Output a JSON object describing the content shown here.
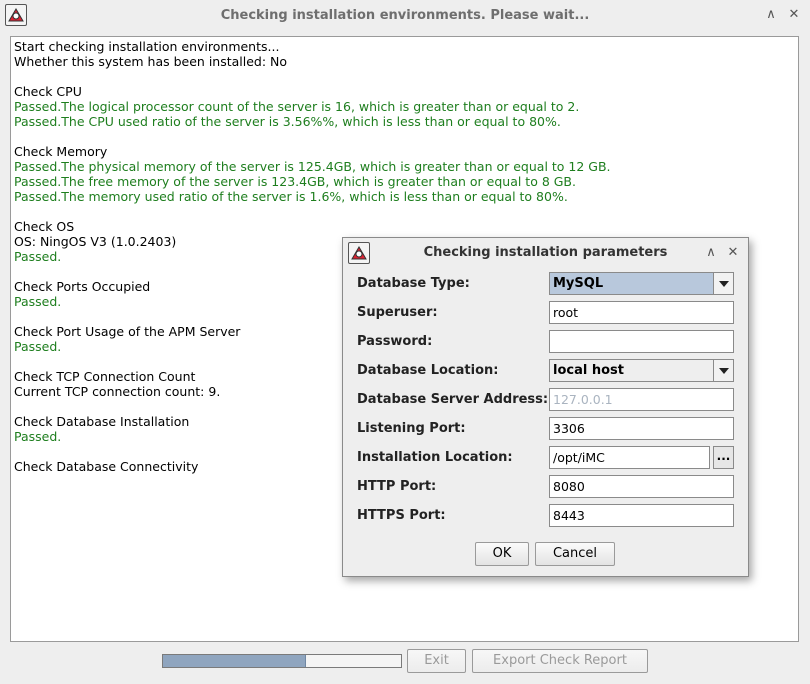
{
  "window": {
    "title": "Checking installation environments. Please wait...",
    "minimize_glyph": "∧",
    "close_glyph": "✕"
  },
  "log": {
    "lines": [
      {
        "text": "Start checking installation environments...",
        "status": "normal"
      },
      {
        "text": "Whether this system has been installed: No",
        "status": "normal"
      },
      {
        "text": "",
        "status": "normal"
      },
      {
        "text": "Check CPU",
        "status": "normal"
      },
      {
        "text": "Passed.The logical processor count of the server is 16, which is greater than or equal to 2.",
        "status": "passed"
      },
      {
        "text": "Passed.The CPU used ratio of the server is 3.56%%, which is less than or equal to 80%.",
        "status": "passed"
      },
      {
        "text": "",
        "status": "normal"
      },
      {
        "text": "Check Memory",
        "status": "normal"
      },
      {
        "text": "Passed.The physical memory of the server is 125.4GB, which is greater than or equal to 12 GB.",
        "status": "passed"
      },
      {
        "text": "Passed.The free memory of the server is 123.4GB, which is greater than or equal to 8 GB.",
        "status": "passed"
      },
      {
        "text": "Passed.The memory used ratio of the server is 1.6%, which is less than or equal to 80%.",
        "status": "passed"
      },
      {
        "text": "",
        "status": "normal"
      },
      {
        "text": "Check OS",
        "status": "normal"
      },
      {
        "text": "OS: NingOS V3 (1.0.2403)",
        "status": "normal"
      },
      {
        "text": "Passed.",
        "status": "passed"
      },
      {
        "text": "",
        "status": "normal"
      },
      {
        "text": "Check Ports Occupied",
        "status": "normal"
      },
      {
        "text": "Passed.",
        "status": "passed"
      },
      {
        "text": "",
        "status": "normal"
      },
      {
        "text": "Check Port Usage of the APM Server",
        "status": "normal"
      },
      {
        "text": "Passed.",
        "status": "passed"
      },
      {
        "text": "",
        "status": "normal"
      },
      {
        "text": "Check TCP Connection Count",
        "status": "normal"
      },
      {
        "text": "Current TCP connection count: 9.",
        "status": "normal"
      },
      {
        "text": "",
        "status": "normal"
      },
      {
        "text": "Check Database Installation",
        "status": "normal"
      },
      {
        "text": "Passed.",
        "status": "passed"
      },
      {
        "text": "",
        "status": "normal"
      },
      {
        "text": "Check Database Connectivity",
        "status": "normal"
      }
    ]
  },
  "footer": {
    "progress_fraction": 0.6,
    "exit_label": "Exit",
    "export_label": "Export Check Report"
  },
  "dialog": {
    "title": "Checking installation parameters",
    "minimize_glyph": "∧",
    "close_glyph": "✕",
    "fields": {
      "database_type": {
        "label": "Database Type:",
        "value": "MySQL"
      },
      "superuser": {
        "label": "Superuser:",
        "value": "root"
      },
      "password": {
        "label": "Password:",
        "value": ""
      },
      "database_location": {
        "label": "Database Location:",
        "value": "local host"
      },
      "server_address": {
        "label": "Database Server Address:",
        "value": "127.0.0.1"
      },
      "listening_port": {
        "label": "Listening Port:",
        "value": "3306"
      },
      "install_location": {
        "label": "Installation Location:",
        "value": "/opt/iMC",
        "browse_label": "..."
      },
      "http_port": {
        "label": "HTTP Port:",
        "value": "8080"
      },
      "https_port": {
        "label": "HTTPS Port:",
        "value": "8443"
      }
    },
    "ok_label": "OK",
    "cancel_label": "Cancel"
  },
  "colors": {
    "passed_text": "#1e7e1e",
    "selected_combo": "#b8c8dc",
    "progress_fill": "#8fa5bf"
  },
  "icons": {
    "app": "java-duke-icon",
    "minimize": "chevron-up-icon",
    "close": "close-icon",
    "dropdown": "chevron-down-icon"
  }
}
